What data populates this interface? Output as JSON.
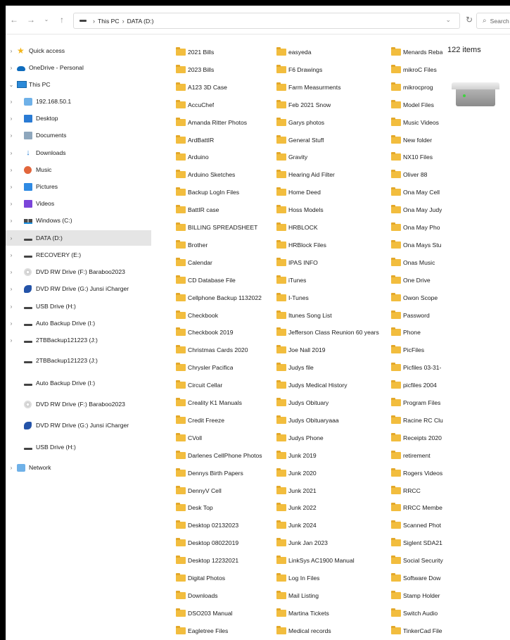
{
  "address": {
    "path": [
      "This PC",
      "DATA (D:)"
    ],
    "search_placeholder": "Search D"
  },
  "sidebar": {
    "items": [
      {
        "label": "Quick access",
        "icon": "star-icon"
      },
      {
        "label": "OneDrive - Personal",
        "icon": "cloud-icon"
      },
      {
        "label": "This PC",
        "icon": "computer-icon"
      },
      {
        "label": "192.168.50.1",
        "icon": "network-folder-icon"
      },
      {
        "label": "Desktop",
        "icon": "desktop-icon"
      },
      {
        "label": "Documents",
        "icon": "documents-icon"
      },
      {
        "label": "Downloads",
        "icon": "download-icon"
      },
      {
        "label": "Music",
        "icon": "music-icon"
      },
      {
        "label": "Pictures",
        "icon": "pictures-icon"
      },
      {
        "label": "Videos",
        "icon": "videos-icon"
      },
      {
        "label": "Windows (C:)",
        "icon": "windows-drive-icon"
      },
      {
        "label": "DATA (D:)",
        "icon": "drive-icon"
      },
      {
        "label": "RECOVERY (E:)",
        "icon": "drive-icon"
      },
      {
        "label": "DVD RW Drive (F:) Baraboo2023",
        "icon": "dvd-icon"
      },
      {
        "label": "DVD RW Drive (G:) Junsi iCharger",
        "icon": "charger-icon"
      },
      {
        "label": "USB Drive (H:)",
        "icon": "drive-icon"
      },
      {
        "label": "Auto Backup Drive (I:)",
        "icon": "drive-icon"
      },
      {
        "label": "2TBBackup121223 (J:)",
        "icon": "drive-icon"
      },
      {
        "label": "2TBBackup121223 (J:)",
        "icon": "drive-icon"
      },
      {
        "label": "Auto Backup Drive (I:)",
        "icon": "drive-icon"
      },
      {
        "label": "DVD RW Drive (F:) Baraboo2023",
        "icon": "dvd-icon"
      },
      {
        "label": "DVD RW Drive (G:) Junsi iCharger",
        "icon": "charger-icon"
      },
      {
        "label": "USB Drive (H:)",
        "icon": "drive-icon"
      },
      {
        "label": "Network",
        "icon": "network-icon"
      }
    ]
  },
  "files": {
    "col1": [
      "2021 Bills",
      "2023 Bills",
      "A123 3D Case",
      "AccuChef",
      "Amanda Ritter Photos",
      "ArdBattIR",
      "Arduino",
      "Arduino Sketches",
      "Backup LogIn Files",
      "BattIR case",
      "BILLING SPREADSHEET",
      "Brother",
      "Calendar",
      "CD Database File",
      "Cellphone Backup 1132022",
      "Checkbook",
      "Checkbook 2019",
      "Christmas Cards 2020",
      "Chrysler Pacifica",
      "Circuit Cellar",
      "Creality K1 Manuals",
      "Credit Freeze",
      "CVoll",
      "Darlenes CellPhone Photos",
      "Dennys Birth Papers",
      "DennyV Cell",
      "Desk Top",
      "Desktop 02132023",
      "Desktop 08022019",
      "Desktop 12232021",
      "Digital Photos",
      "Downloads",
      "DSO203 Manual",
      "Eagletree Files"
    ],
    "col2": [
      "easyeda",
      "F6 Drawings",
      "Farm Measurments",
      "Feb 2021 Snow",
      "Garys photos",
      "General Stuff",
      "Gravity",
      "Hearing Aid Filter",
      "Home Deed",
      "Hoss Models",
      "HRBLOCK",
      "HRBlock Files",
      "IPAS INFO",
      "iTunes",
      "I-Tunes",
      "Itunes Song List",
      "Jefferson Class Reunion 60 years",
      "Joe Nall 2019",
      "Judys file",
      "Judys Medical History",
      "Judys Obituary",
      "Judys Obituaryaaa",
      "Judys Phone",
      "Junk 2019",
      "Junk 2020",
      "Junk 2021",
      "Junk 2022",
      "Junk 2024",
      "Junk Jan 2023",
      "LinkSys AC1900 Manual",
      "Log In Files",
      "Mail Listing",
      "Martina Tickets",
      "Medical records"
    ],
    "col3": [
      "Menards Reba",
      "mikroC Files",
      "mikrocprog",
      "Model Files",
      "Music Videos",
      "New folder",
      "NX10 Files",
      "Oliver 88",
      "Ona May Cell",
      "Ona May Judy",
      "Ona May Pho",
      "Ona Mays Stu",
      "Onas Music",
      "One Drive",
      "Owon Scope",
      "Password",
      "Phone",
      "PicFiles",
      "Picfiles 03-31-",
      "picfiles 2004",
      "Program Files",
      "Racine RC Clu",
      "Receipts 2020",
      "retirement",
      "Rogers Videos",
      "RRCC",
      "RRCC Membe",
      "Scanned Phot",
      "Siglent SDA21",
      "Social Security",
      "Software Dow",
      "Stamp Holder",
      "Switch Audio",
      "TinkerCad File"
    ]
  },
  "details": {
    "item_count": "122 items"
  }
}
